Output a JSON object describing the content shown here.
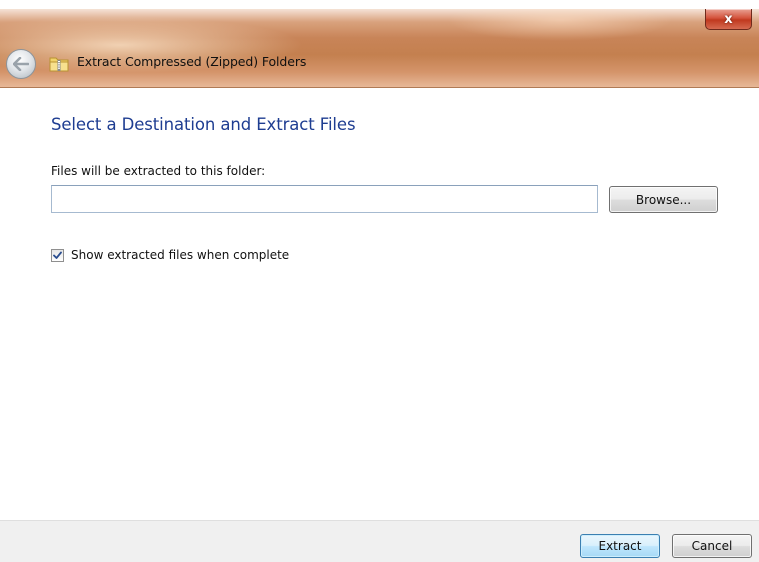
{
  "window": {
    "title": "Extract Compressed (Zipped) Folders",
    "close_glyph": "x"
  },
  "icons": {
    "back": "back-arrow-icon",
    "folder": "zipped-folder-icon",
    "close": "close-icon",
    "check": "checkmark-icon"
  },
  "main": {
    "heading": "Select a Destination and Extract Files",
    "path_label": "Files will be extracted to this folder:",
    "path_value": "",
    "browse_label": "Browse...",
    "show_files_label": "Show extracted files when complete",
    "show_files_checked": true
  },
  "footer": {
    "extract_label": "Extract",
    "cancel_label": "Cancel"
  },
  "colors": {
    "heading": "#1e3d91",
    "titlebar_accent": "#c4804f",
    "close_button": "#c0391f",
    "default_button_border": "#3c7fb1"
  }
}
